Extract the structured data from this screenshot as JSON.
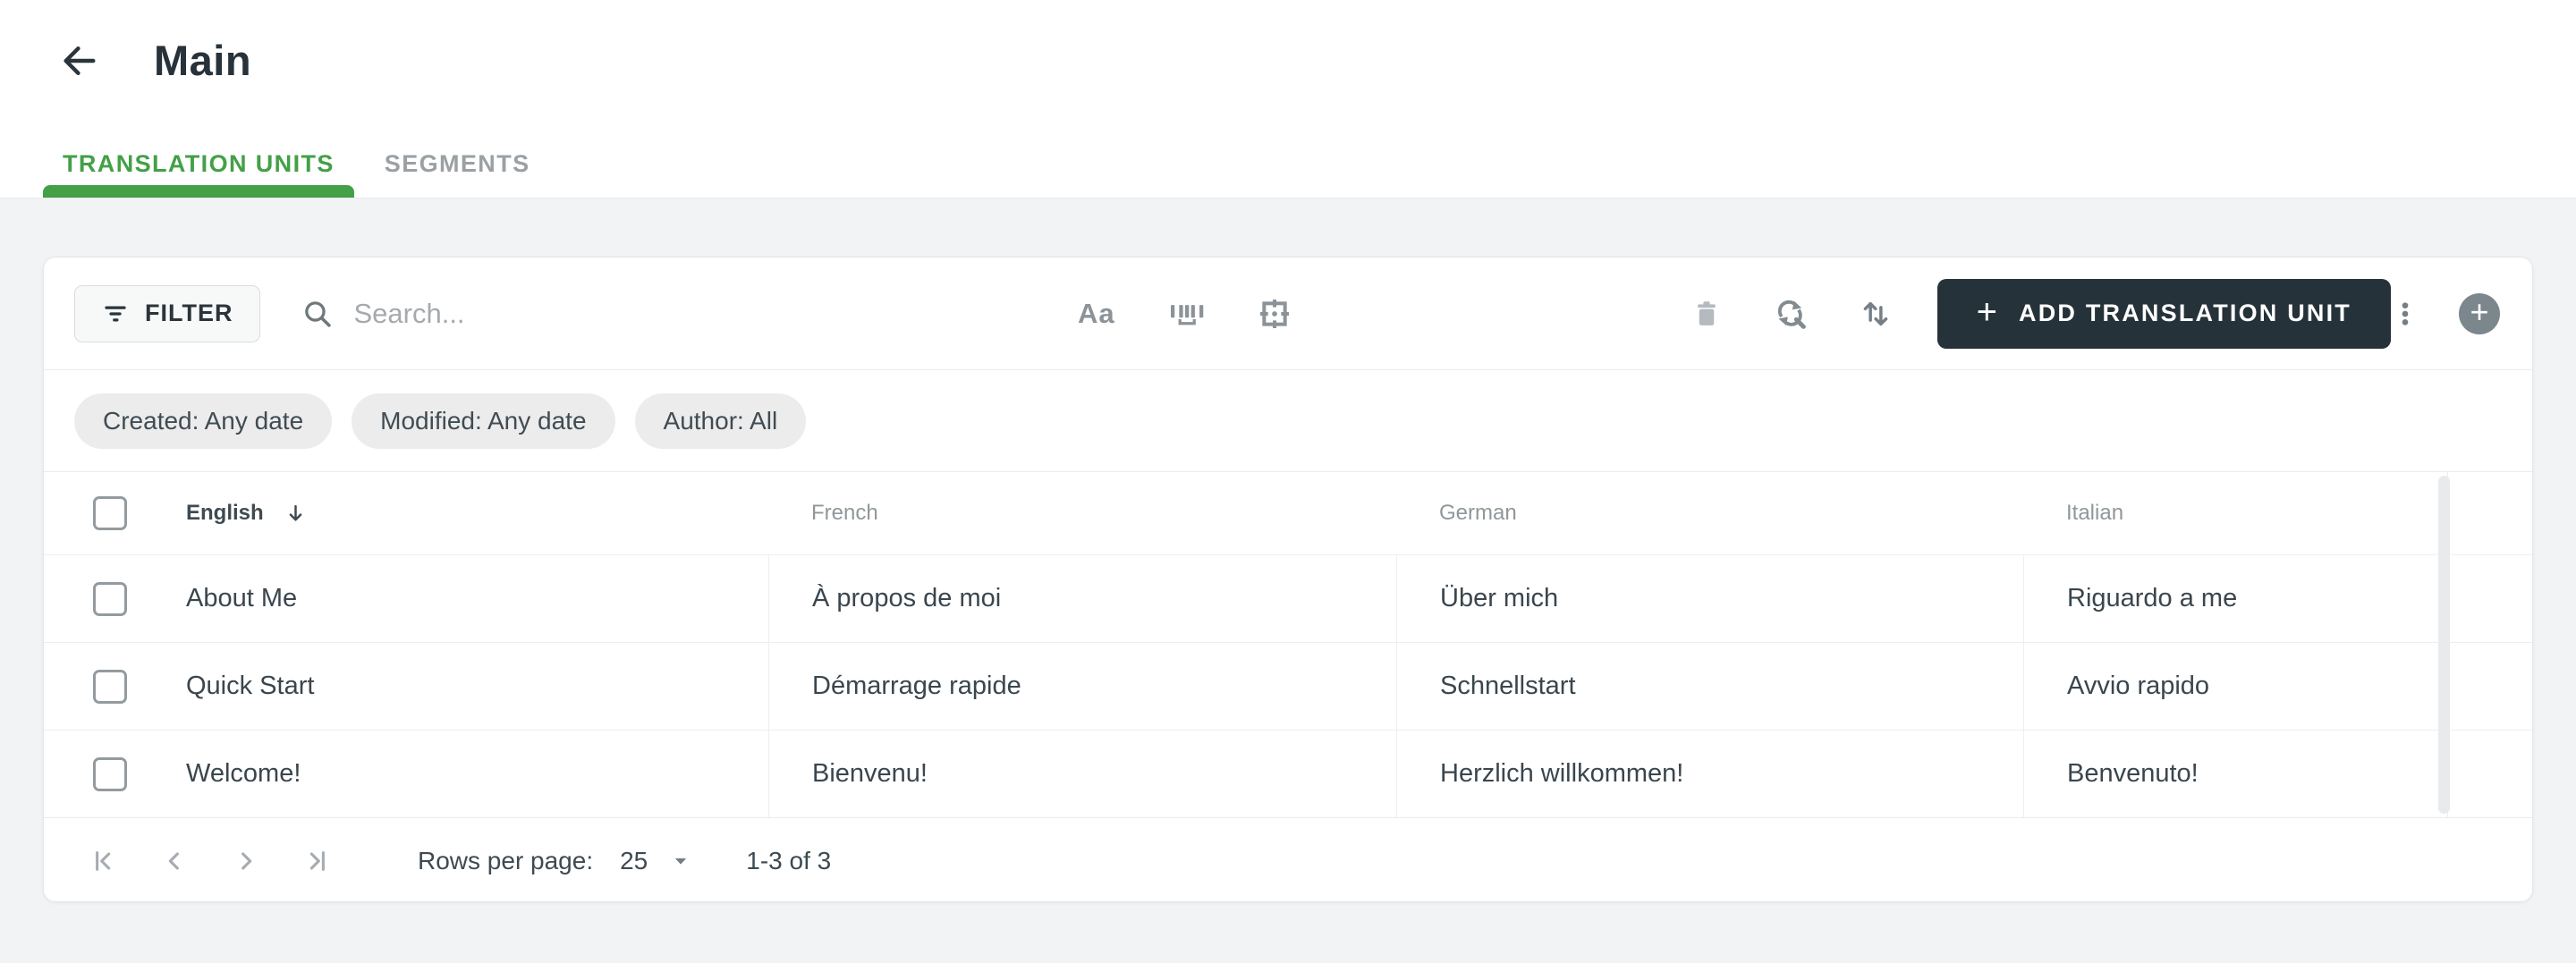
{
  "header": {
    "title": "Main"
  },
  "tabs": [
    {
      "label": "TRANSLATION UNITS",
      "active": true
    },
    {
      "label": "SEGMENTS",
      "active": false
    }
  ],
  "toolbar": {
    "filter_label": "FILTER",
    "search_placeholder": "Search...",
    "match_case_label": "Aa",
    "add_button_label": "ADD TRANSLATION UNIT"
  },
  "chips": [
    "Created: Any date",
    "Modified: Any date",
    "Author: All"
  ],
  "table": {
    "columns": [
      "English",
      "French",
      "German",
      "Italian"
    ],
    "sorted_column": "English",
    "sort_direction": "desc",
    "rows": [
      {
        "cells": [
          "About Me",
          "À propos de moi",
          "Über mich",
          "Riguardo a me"
        ]
      },
      {
        "cells": [
          "Quick Start",
          "Démarrage rapide",
          "Schnellstart",
          "Avvio rapido"
        ]
      },
      {
        "cells": [
          "Welcome!",
          "Bienvenu!",
          "Herzlich willkommen!",
          "Benvenuto!"
        ]
      }
    ]
  },
  "pagination": {
    "rows_per_page_label": "Rows per page:",
    "rows_per_page_value": "25",
    "range_label": "1-3 of 3"
  },
  "colors": {
    "accent_green": "#43a047",
    "dark_button": "#263239",
    "page_background": "#f2f3f4",
    "chip_background": "#ececec"
  }
}
